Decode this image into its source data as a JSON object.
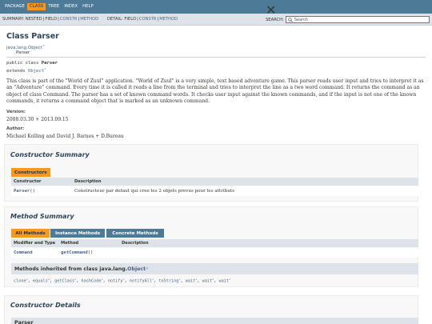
{
  "nav": {
    "items": [
      "PACKAGE",
      "CLASS",
      "TREE",
      "INDEX",
      "HELP"
    ],
    "active_index": 1
  },
  "subnav": {
    "summary_label": "SUMMARY: NESTED",
    "summary_sep": "|",
    "summary_field": "FIELD",
    "summary_constr": "CONSTR",
    "summary_method": "METHOD",
    "detail_label": "DETAIL: FIELD",
    "detail_constr": "CONSTR",
    "detail_method": "METHOD",
    "search_label": "SEARCH:",
    "search_placeholder": "Search",
    "reset_glyph": "✕"
  },
  "header": {
    "title": "Class Parser",
    "super_link": "java.lang.Object",
    "class_name": "Parser"
  },
  "declaration": {
    "line1_prefix": "public class ",
    "line1_name": "Parser",
    "line2_prefix": "extends ",
    "line2_link": "Object"
  },
  "description": "This class is part of the \"World of Zuul\" application. \"World of Zuul\" is a very simple, text based adventure game. This parser reads user input and tries to interpret it as an \"Adventure\" command. Every time it is called it reads a line from the terminal and tries to interpret the line as a two word command. It returns the command as an object of class Command. The parser has a set of known command words. It checks user input against the known commands, and if the input is not one of the known commands, it returns a command object that is marked as an unknown command.",
  "version_label": "Version:",
  "version_value": "2008.03.30 + 2013.09.15",
  "author_label": "Author:",
  "author_value": "Michael Kolling and David J. Barnes + D.Bureau",
  "constructor_summary": {
    "title": "Constructor Summary",
    "tab": "Constructors",
    "col1": "Constructor",
    "col2": "Description",
    "row_name": "Parser",
    "row_parens": "()",
    "row_desc": "Constructeur par defaut qui cree les 2 objets prevus pour les attributs"
  },
  "method_summary": {
    "title": "Method Summary",
    "tabs": [
      "All Methods",
      "Instance Methods",
      "Concrete Methods"
    ],
    "col1": "Modifier and Type",
    "col2": "Method",
    "col3": "Description",
    "row_type": "Command",
    "row_method": "getCommand",
    "row_parens": "()",
    "inherited_prefix": "Methods inherited from class java.lang.",
    "inherited_link": "Object",
    "inherited_methods": [
      "clone",
      "equals",
      "getClass",
      "hashCode",
      "notify",
      "notifyAll",
      "toString",
      "wait",
      "wait",
      "wait"
    ]
  },
  "constructor_details": {
    "title": "Constructor Details",
    "item": "Parser"
  }
}
